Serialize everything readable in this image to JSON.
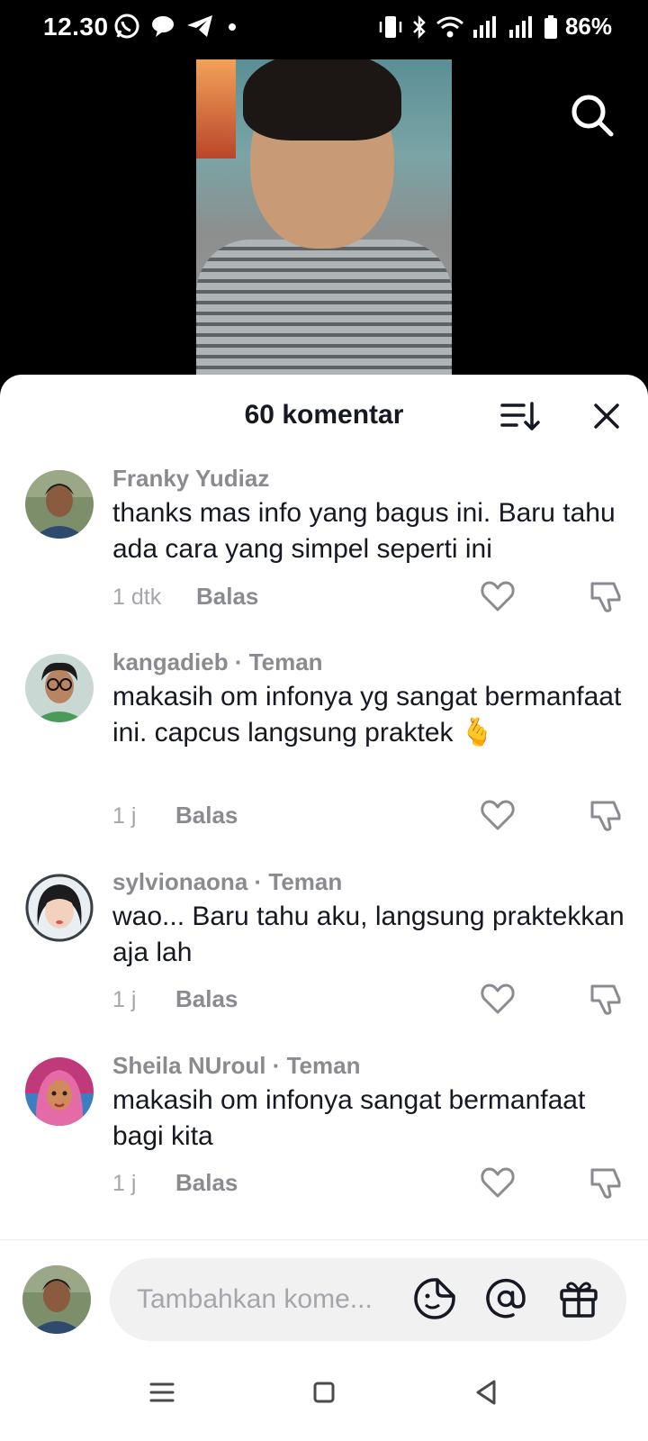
{
  "status_bar": {
    "time": "12.30",
    "battery": "86%",
    "left_icons": [
      "whatsapp-icon",
      "chat-bubble-icon",
      "telegram-icon",
      "dot-icon"
    ],
    "right_icons": [
      "vibrate-icon",
      "bluetooth-icon",
      "wifi-icon",
      "signal-icon",
      "signal-icon",
      "battery-icon"
    ]
  },
  "sheet": {
    "title": "60 komentar"
  },
  "comments": [
    {
      "username": "Franky Yudiaz",
      "text": "thanks mas info yang bagus ini. Baru tahu ada cara yang simpel seperti ini",
      "time": "1 dtk",
      "reply": "Balas"
    },
    {
      "username": "kangadieb · Teman",
      "text": "makasih om infonya yg sangat bermanfaat ini. capcus langsung praktek 🫰",
      "time": "1 j",
      "reply": "Balas"
    },
    {
      "username": "sylvionaona · Teman",
      "text": "wao... Baru tahu aku, langsung praktekkan aja lah",
      "time": "1 j",
      "reply": "Balas"
    },
    {
      "username": "Sheila NUroul · Teman",
      "text": "makasih om infonya sangat bermanfaat bagi kita",
      "time": "1 j",
      "reply": "Balas"
    }
  ],
  "composer": {
    "placeholder": "Tambahkan kome..."
  },
  "colors": {
    "primary_text": "#161823",
    "secondary_text": "#8a8b91",
    "input_bg": "#f1f1f2"
  }
}
